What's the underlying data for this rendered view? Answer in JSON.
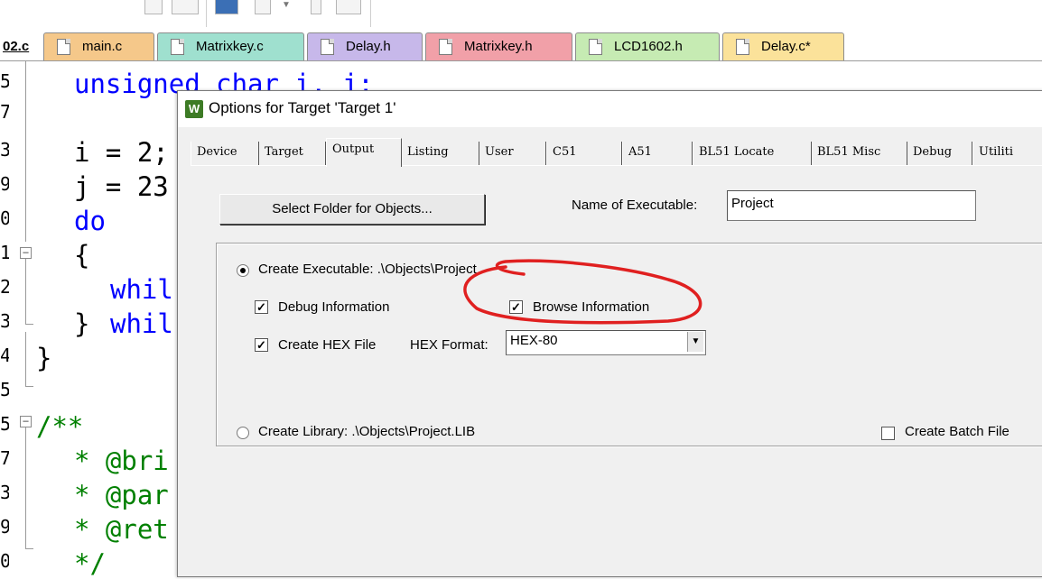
{
  "editor_tabs": [
    {
      "label": "02.c",
      "bg": "#ffffff",
      "active": true
    },
    {
      "label": "main.c",
      "bg": "#f5c88a"
    },
    {
      "label": "Matrixkey.c",
      "bg": "#9fe0cf"
    },
    {
      "label": "Delay.h",
      "bg": "#c7b8ea"
    },
    {
      "label": "Matrixkey.h",
      "bg": "#f1a0a8"
    },
    {
      "label": "LCD1602.h",
      "bg": "#c6ebb3"
    },
    {
      "label": "Delay.c*",
      "bg": "#fbe29a"
    }
  ],
  "gutter": [
    "5",
    "7",
    "3",
    "9",
    "0",
    "1",
    "2",
    "3",
    "4",
    "5",
    "5",
    "7",
    "3",
    "9",
    "0"
  ],
  "code": {
    "l1_kw": "unsigned char i, j;",
    "l3": "i = 2;",
    "l4": "j = 23",
    "l5_kw": "do",
    "l6": "{",
    "l7_kw": "whil",
    "l8": "} ",
    "l8_kw": "whil",
    "l9": "}",
    "c1": "/**",
    "c2": "* @bri",
    "c3": "* @par",
    "c4": "* @ret",
    "c5": "*/"
  },
  "dialog": {
    "title": "Options for Target 'Target 1'",
    "icon_text": "W",
    "tabs": [
      {
        "label": "Device"
      },
      {
        "label": "Target"
      },
      {
        "label": "Output",
        "active": true
      },
      {
        "label": "Listing"
      },
      {
        "label": "User"
      },
      {
        "label": "C51"
      },
      {
        "label": "A51"
      },
      {
        "label": "BL51 Locate"
      },
      {
        "label": "BL51 Misc"
      },
      {
        "label": "Debug"
      },
      {
        "label": "Utiliti"
      }
    ],
    "select_folder_button": "Select Folder for Objects...",
    "name_of_executable_label": "Name of Executable:",
    "name_of_executable_value": "Project",
    "create_executable_label": "Create Executable:  .\\Objects\\Project",
    "create_executable_selected": true,
    "debug_information_label": "Debug Information",
    "debug_information_checked": true,
    "browse_information_label": "Browse Information",
    "browse_information_checked": true,
    "create_hex_label": "Create HEX File",
    "create_hex_checked": true,
    "hex_format_label": "HEX Format:",
    "hex_format_value": "HEX-80",
    "create_library_label": "Create Library:  .\\Objects\\Project.LIB",
    "create_library_selected": false,
    "create_batch_label": "Create Batch File",
    "create_batch_checked": false
  },
  "colors": {
    "keyword": "#0000ff",
    "comment": "#008000",
    "annotation": "#e02020"
  }
}
